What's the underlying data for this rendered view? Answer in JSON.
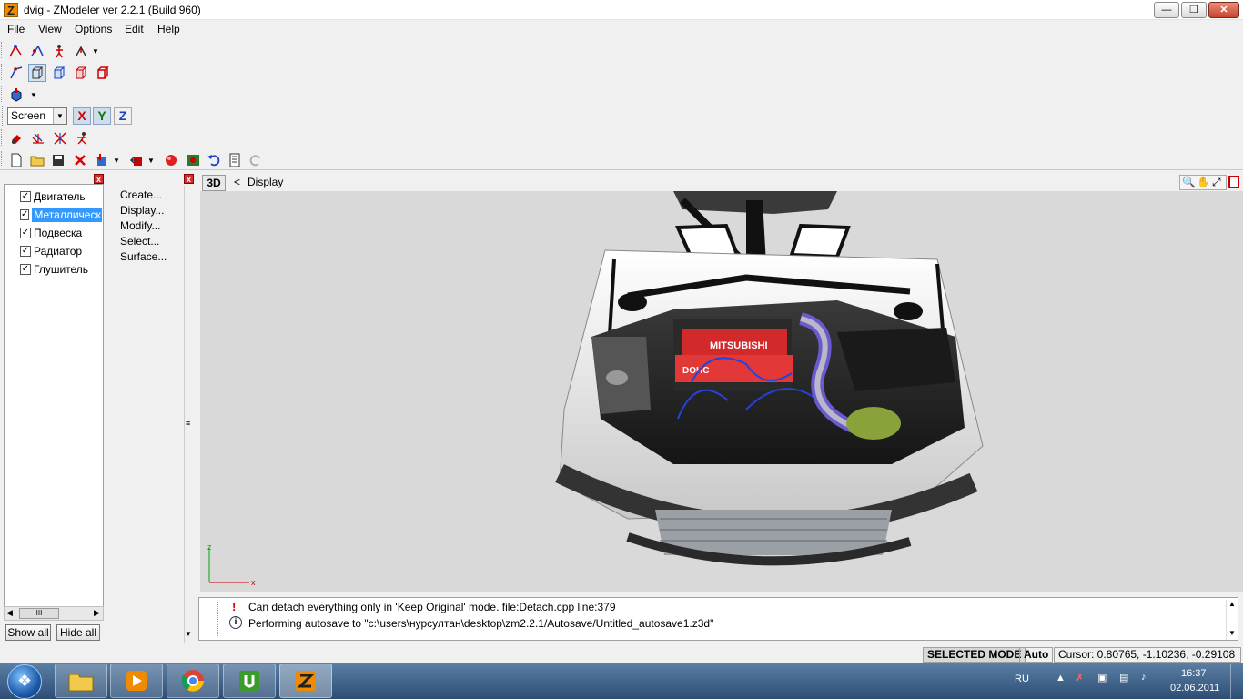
{
  "window": {
    "title": "dvig - ZModeler ver 2.2.1 (Build 960)",
    "app_icon_letter": "Z",
    "minimize_icon": "minimize-icon",
    "maximize_icon": "restore-icon",
    "close_icon": "close-icon"
  },
  "menu": [
    "File",
    "View",
    "Options",
    "Edit",
    "Help"
  ],
  "toolbar": {
    "coord_system": "Screen",
    "axes": [
      "X",
      "Y",
      "Z"
    ],
    "axis_colors": {
      "X": "#cc0000",
      "Y": "#0a7a0a",
      "Z": "#1a3fc0"
    }
  },
  "objects_panel": {
    "items": [
      {
        "label": "Двигатель",
        "checked": true,
        "selected": false
      },
      {
        "label": "Металлическ",
        "checked": true,
        "selected": true
      },
      {
        "label": "Подвеска",
        "checked": true,
        "selected": false
      },
      {
        "label": "Радиатор",
        "checked": true,
        "selected": false
      },
      {
        "label": "Глушитель",
        "checked": true,
        "selected": false
      }
    ],
    "show_all": "Show all",
    "hide_all": "Hide all",
    "scroll_thumb": "III"
  },
  "commands_panel": {
    "items": [
      "Create...",
      "Display...",
      "Modify...",
      "Select...",
      "Surface..."
    ]
  },
  "viewport": {
    "mode": "3D",
    "breadcrumb_arrow": "<",
    "breadcrumb": "Display",
    "axis_x": "x",
    "axis_z": "z",
    "engine_brand": "MITSUBISHI",
    "engine_label": "DOHC"
  },
  "log": [
    {
      "icon": "!",
      "text": "Can detach everything only in 'Keep Original' mode. file:Detach.cpp line:379"
    },
    {
      "icon": "i",
      "text": "Performing autosave to \"c:\\users\\нурсултан\\desktop\\zm2.2.1/Autosave/Untitled_autosave1.z3d\""
    }
  ],
  "status": {
    "mode": "SELECTED MODE",
    "auto": "Auto",
    "cursor": "Cursor: 0.80765, -1.10236, -0.29108"
  },
  "taskbar": {
    "lang": "RU",
    "time": "16:37",
    "date": "02.06.2011",
    "start_label": "start-orb"
  }
}
